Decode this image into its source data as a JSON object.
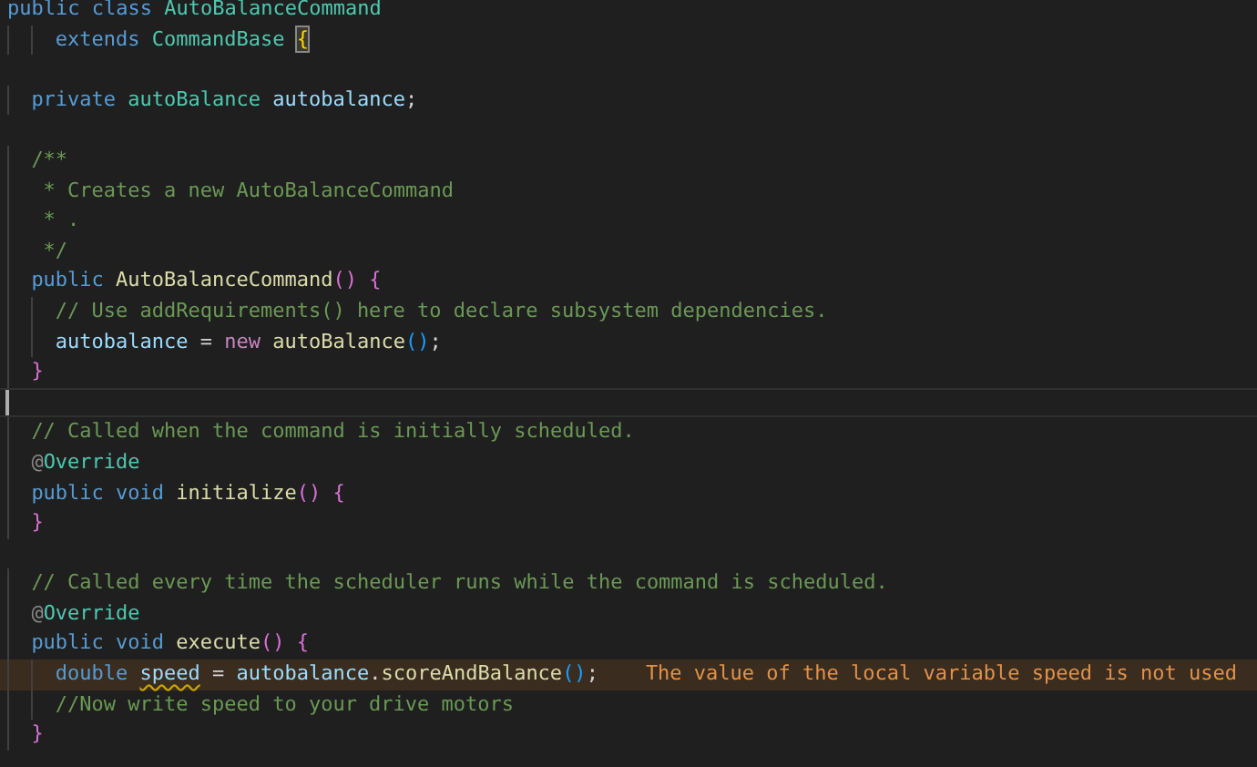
{
  "editor": {
    "lines": [
      {
        "kind": "code",
        "tokens": [
          {
            "text": "public",
            "kind": "keyword"
          },
          {
            "text": " class",
            "kind": "keyword"
          },
          {
            "text": " AutoBalanceCommand",
            "kind": "type"
          }
        ]
      },
      {
        "kind": "code",
        "tokens": [
          {
            "text": "    extends",
            "kind": "keyword"
          },
          {
            "text": " CommandBase ",
            "kind": "type"
          },
          {
            "text": "{",
            "kind": "bracket1",
            "matched": true
          }
        ]
      },
      {
        "kind": "blank"
      },
      {
        "kind": "code",
        "tokens": [
          {
            "text": "  private",
            "kind": "keyword"
          },
          {
            "text": " autoBalance",
            "kind": "type"
          },
          {
            "text": " autobalance",
            "kind": "variable"
          },
          {
            "text": ";",
            "kind": "punct"
          }
        ]
      },
      {
        "kind": "blank"
      },
      {
        "kind": "code",
        "tokens": [
          {
            "text": "  /**",
            "kind": "comment"
          }
        ]
      },
      {
        "kind": "code",
        "tokens": [
          {
            "text": "   * Creates a new AutoBalanceCommand",
            "kind": "comment"
          }
        ]
      },
      {
        "kind": "code",
        "tokens": [
          {
            "text": "   * .",
            "kind": "comment"
          }
        ]
      },
      {
        "kind": "code",
        "tokens": [
          {
            "text": "   */",
            "kind": "comment"
          }
        ]
      },
      {
        "kind": "code",
        "tokens": [
          {
            "text": "  public",
            "kind": "keyword"
          },
          {
            "text": " AutoBalanceCommand",
            "kind": "function"
          },
          {
            "text": "()",
            "kind": "bracket2"
          },
          {
            "text": " {",
            "kind": "bracket2"
          }
        ]
      },
      {
        "kind": "code",
        "tokens": [
          {
            "text": "    // Use addRequirements() here to declare subsystem dependencies.",
            "kind": "comment"
          }
        ]
      },
      {
        "kind": "code",
        "tokens": [
          {
            "text": "    autobalance",
            "kind": "variable"
          },
          {
            "text": " = ",
            "kind": "punct"
          },
          {
            "text": "new",
            "kind": "control"
          },
          {
            "text": " autoBalance",
            "kind": "function"
          },
          {
            "text": "()",
            "kind": "bracket3"
          },
          {
            "text": ";",
            "kind": "punct"
          }
        ]
      },
      {
        "kind": "code",
        "tokens": [
          {
            "text": "  }",
            "kind": "bracket2"
          }
        ]
      },
      {
        "kind": "cursor"
      },
      {
        "kind": "code",
        "tokens": [
          {
            "text": "  // Called when the command is initially scheduled.",
            "kind": "comment"
          }
        ]
      },
      {
        "kind": "code",
        "tokens": [
          {
            "text": "  @",
            "kind": "at"
          },
          {
            "text": "Override",
            "kind": "type"
          }
        ]
      },
      {
        "kind": "code",
        "tokens": [
          {
            "text": "  public",
            "kind": "keyword"
          },
          {
            "text": " void",
            "kind": "keyword"
          },
          {
            "text": " initialize",
            "kind": "function"
          },
          {
            "text": "()",
            "kind": "bracket2"
          },
          {
            "text": " {",
            "kind": "bracket2"
          }
        ]
      },
      {
        "kind": "code",
        "tokens": [
          {
            "text": "  }",
            "kind": "bracket2"
          }
        ]
      },
      {
        "kind": "blank"
      },
      {
        "kind": "code",
        "tokens": [
          {
            "text": "  // Called every time the scheduler runs while the command is scheduled.",
            "kind": "comment"
          }
        ]
      },
      {
        "kind": "code",
        "tokens": [
          {
            "text": "  @",
            "kind": "at"
          },
          {
            "text": "Override",
            "kind": "type"
          }
        ]
      },
      {
        "kind": "code",
        "tokens": [
          {
            "text": "  public",
            "kind": "keyword"
          },
          {
            "text": " void",
            "kind": "keyword"
          },
          {
            "text": " execute",
            "kind": "function"
          },
          {
            "text": "()",
            "kind": "bracket2"
          },
          {
            "text": " {",
            "kind": "bracket2"
          }
        ]
      },
      {
        "kind": "code",
        "warning": "The value of the local variable speed is not used",
        "tokens": [
          {
            "text": "    double ",
            "kind": "keyword"
          },
          {
            "text": "speed",
            "kind": "variable",
            "underline": true
          },
          {
            "text": " = ",
            "kind": "punct"
          },
          {
            "text": "autobalance",
            "kind": "variable"
          },
          {
            "text": ".",
            "kind": "punct"
          },
          {
            "text": "scoreAndBalance",
            "kind": "function"
          },
          {
            "text": "()",
            "kind": "bracket3"
          },
          {
            "text": ";",
            "kind": "punct"
          }
        ]
      },
      {
        "kind": "code",
        "tokens": [
          {
            "text": "    //Now write speed to your drive motors",
            "kind": "comment"
          }
        ]
      },
      {
        "kind": "code",
        "tokens": [
          {
            "text": "  }",
            "kind": "bracket2"
          }
        ]
      }
    ]
  }
}
